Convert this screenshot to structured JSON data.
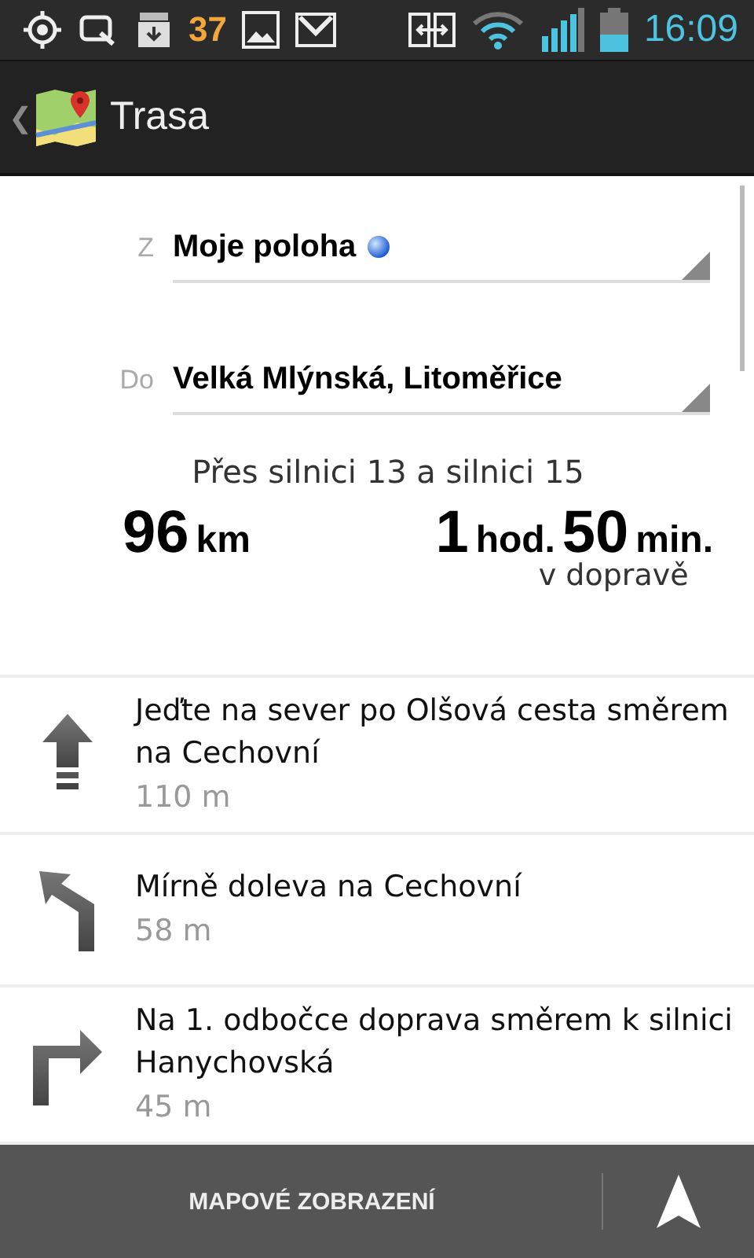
{
  "status_bar": {
    "notification_count": "37",
    "time": "16:09"
  },
  "action_bar": {
    "back": "❮",
    "title": "Trasa"
  },
  "route": {
    "fields": [
      {
        "label": "Z",
        "value": "Moje poloha",
        "kind": "current-location"
      },
      {
        "label": "Do",
        "value": "Velká Mlýnská, Litoměřice",
        "kind": "address"
      }
    ],
    "via": "Přes silnici 13 a silnici 15",
    "distance": {
      "number": "96",
      "unit": "km"
    },
    "duration": {
      "hours": "1",
      "hours_unit": "hod.",
      "minutes": "50",
      "minutes_unit": "min.",
      "note": "v dopravě"
    }
  },
  "steps": [
    {
      "kind": "straight",
      "instruction": "Jeďte na sever po Olšová cesta směrem na Cechovní",
      "distance": "110 m"
    },
    {
      "kind": "slight-left",
      "instruction": "Mírně doleva na Cechovní",
      "distance": "58 m"
    },
    {
      "kind": "right",
      "instruction": "Na 1. odbočce doprava směrem k silnici Hanychovská",
      "distance": "45 m"
    }
  ],
  "bottom_bar": {
    "button": "MAPOVÉ ZOBRAZENÍ"
  }
}
